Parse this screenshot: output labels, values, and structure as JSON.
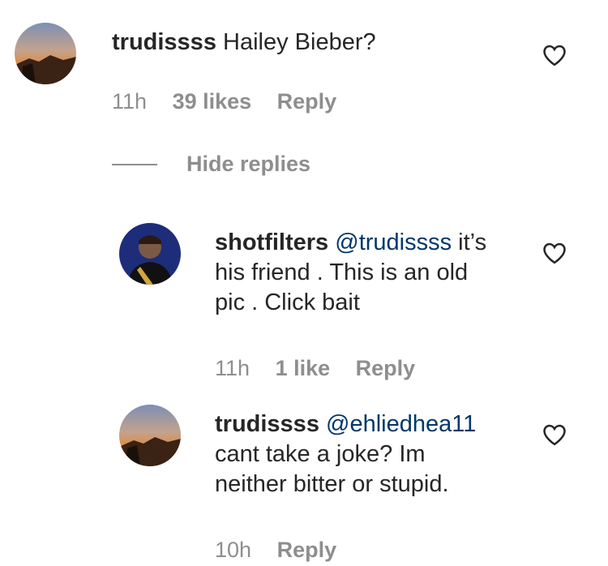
{
  "comments": [
    {
      "username": "trudissss",
      "mention": "",
      "text": "Hailey Bieber?",
      "time": "11h",
      "likes": "39 likes",
      "reply_label": "Reply"
    },
    {
      "username": "shotfilters",
      "mention": "@trudissss",
      "text_line1": "it’s",
      "text_line2": "his friend . This is an old",
      "text_line3": "pic . Click bait",
      "time": "11h",
      "likes": "1 like",
      "reply_label": "Reply"
    },
    {
      "username": "trudissss",
      "mention": "@ehliedhea11",
      "text_line1": "cant take a joke? Im",
      "text_line2": "neither bitter or stupid.",
      "time": "10h",
      "reply_label": "Reply"
    }
  ],
  "replies_toggle": {
    "label": "Hide replies"
  },
  "colors": {
    "text": "#262626",
    "meta": "#8e8e8e",
    "mention": "#00376b"
  },
  "icons": {
    "like": "heart-outline-icon"
  }
}
